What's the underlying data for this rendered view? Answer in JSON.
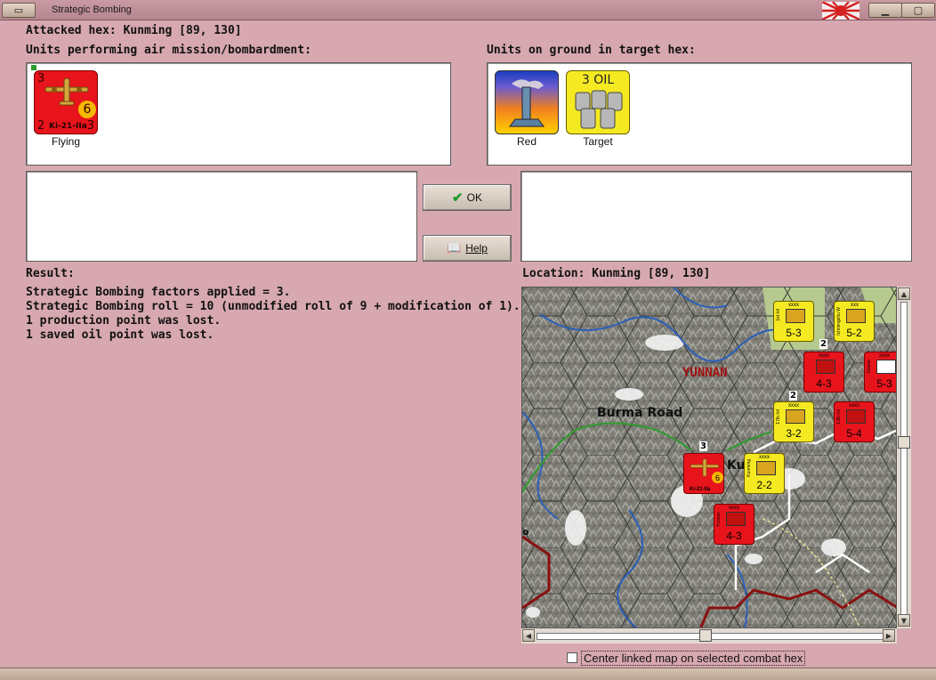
{
  "window": {
    "title": "Strategic Bombing"
  },
  "header": {
    "attacked_hex": "Attacked hex: Kunming  [89, 130]"
  },
  "air_section": {
    "label": "Units performing air mission/bombardment:",
    "units": [
      {
        "name": "Ki-21-IIa",
        "caption": "Flying",
        "top_left": "3",
        "bottom_left": "2",
        "bottom_right": "3",
        "circle": "6",
        "color": "#e8141c",
        "icon": "bomber-plane-icon"
      }
    ]
  },
  "ground_section": {
    "label": "Units on ground in target hex:",
    "units": [
      {
        "caption": "Red",
        "icon": "factory-smokestack-icon"
      },
      {
        "caption": "Target",
        "header": "3 OIL",
        "icon": "oil-barrels-icon"
      }
    ]
  },
  "buttons": {
    "ok": "OK",
    "help": "Help"
  },
  "result": {
    "label": "Result:",
    "lines": [
      "Strategic Bombing factors applied = 3.",
      "Strategic Bombing roll = 10 (unmodified roll of 9 + modification of 1).",
      "1 production point was lost.",
      "1 saved oil point was lost."
    ]
  },
  "location": {
    "label": "Location:  Kunming  [89, 130]"
  },
  "map": {
    "labels": {
      "region": "YUNNAN",
      "road": "Burma Road",
      "city_fragment": "Ku",
      "edge_fragment": "o"
    },
    "units": [
      {
        "id": "u1",
        "top": "xxxx",
        "side": "1st Inf",
        "value": "5-3",
        "color": "#f5ea22",
        "stack": ""
      },
      {
        "id": "u2",
        "top": "xxx",
        "side": "Ichmingchu W",
        "value": "5-2",
        "color": "#f5ea22",
        "stack": ""
      },
      {
        "id": "u3",
        "top": "xxxx",
        "side": "",
        "value": "4-3",
        "color": "#e8141c",
        "stack": "2"
      },
      {
        "id": "u4",
        "top": "xxxx",
        "side": "Ouelar",
        "value": "5-3",
        "color": "#e8141c",
        "stack": ""
      },
      {
        "id": "u5",
        "top": "xxxx",
        "side": "17th Inf",
        "value": "3-2",
        "color": "#f5ea22",
        "stack": "2"
      },
      {
        "id": "u6",
        "top": "xxxx",
        "side": "13th Inf",
        "value": "5-4",
        "color": "#e8141c",
        "stack": ""
      },
      {
        "id": "u7",
        "top": "xxxx",
        "side": "Kunming",
        "value": "2-2",
        "color": "#f5ea22",
        "stack": ""
      },
      {
        "id": "u8",
        "top": "xxxx",
        "side": "Yunnan",
        "value": "4-3",
        "color": "#e8141c",
        "stack": ""
      },
      {
        "id": "u9",
        "top": "",
        "side": "Ki-21-IIa",
        "value": "6",
        "color": "#e8141c",
        "stack": "3"
      }
    ]
  },
  "footer": {
    "checkbox_label": "Center linked map on selected combat hex",
    "checkbox_checked": false
  }
}
